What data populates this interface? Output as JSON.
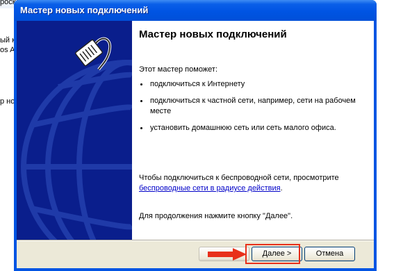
{
  "background_window": {
    "lines": [
      "роско",
      "ый к",
      "os AR",
      "р но"
    ]
  },
  "window": {
    "title": "Мастер новых подключений"
  },
  "content": {
    "heading": "Мастер новых подключений",
    "intro": "Этот мастер поможет:",
    "bullets": [
      "подключиться к Интернету",
      "подключиться к частной сети, например, сети на рабочем месте",
      "установить домашнюю сеть или сеть малого офиса."
    ],
    "wireless_prefix": "Чтобы подключиться к беспроводной сети, просмотрите",
    "wireless_link": "беспроводные сети в радиусе действия",
    "wireless_suffix": ".",
    "continue_text": "Для продолжения нажмите кнопку \"Далее\"."
  },
  "buttons": {
    "back": "",
    "next": "Далее >",
    "cancel": "Отмена"
  },
  "colors": {
    "title_bar": "#0054e3",
    "left_panel": "#0a1e8c",
    "highlight": "#e8301a",
    "link": "#0000c8"
  },
  "icons": {
    "wizard": "network-cable-icon",
    "pointer": "red-arrow-icon"
  }
}
